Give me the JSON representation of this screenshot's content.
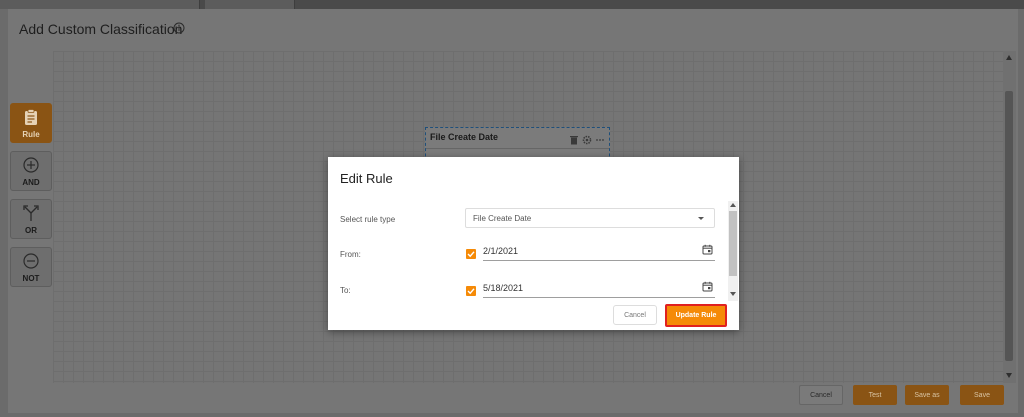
{
  "window": {
    "title": "Add Custom Classification"
  },
  "toolbox": {
    "items": [
      {
        "label": "Rule",
        "icon": "clipboard-icon",
        "active": true
      },
      {
        "label": "AND",
        "icon": "plus-circle-icon",
        "active": false
      },
      {
        "label": "OR",
        "icon": "split-arrows-icon",
        "active": false
      },
      {
        "label": "NOT",
        "icon": "minus-circle-icon",
        "active": false
      }
    ]
  },
  "canvas": {
    "node": {
      "title": "File Create Date"
    }
  },
  "footer": {
    "cancel_label": "Cancel",
    "test_label": "Test",
    "save_as_label": "Save as",
    "save_label": "Save"
  },
  "modal": {
    "title": "Edit Rule",
    "rule_type_label": "Select rule type",
    "rule_type_value": "File Create Date",
    "from_label": "From:",
    "from_checked": true,
    "from_value": "2/1/2021",
    "to_label": "To:",
    "to_checked": true,
    "to_value": "5/18/2021",
    "cancel_label": "Cancel",
    "update_label": "Update Rule"
  },
  "colors": {
    "accent": "#f58a07",
    "highlight_border": "#e02020",
    "overlay": "#6b6b6b"
  }
}
